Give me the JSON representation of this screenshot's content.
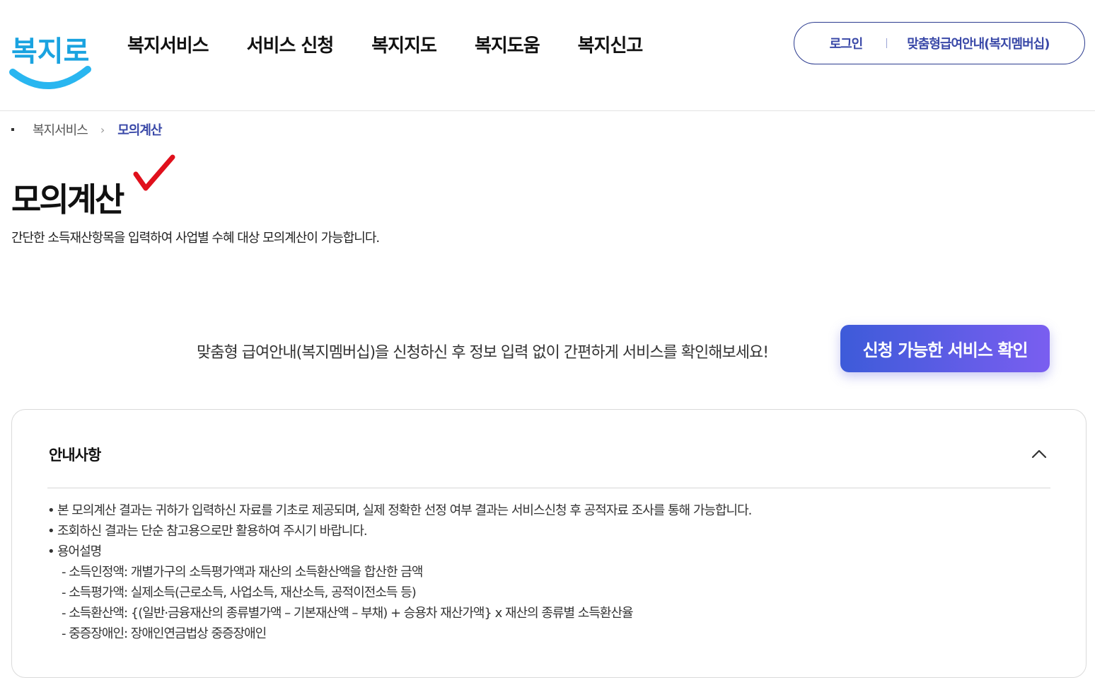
{
  "header": {
    "logo_text": "복지로",
    "nav": [
      "복지서비스",
      "서비스 신청",
      "복지지도",
      "복지도움",
      "복지신고"
    ],
    "auth": {
      "login": "로그인",
      "membership": "맞춤형급여안내(복지멤버십)"
    }
  },
  "breadcrumb": {
    "parent": "복지서비스",
    "current": "모의계산"
  },
  "page": {
    "title": "모의계산",
    "description": "간단한 소득재산항목을 입력하여 사업별 수혜 대상 모의계산이 가능합니다."
  },
  "promo": {
    "text": "맞춤형 급여안내(복지멤버십)을 신청하신 후 정보 입력 없이 간편하게 서비스를 확인해보세요!",
    "button": "신청 가능한 서비스 확인"
  },
  "notice": {
    "title": "안내사항",
    "items": [
      "본 모의계산 결과는 귀하가 입력하신 자료를 기초로 제공되며, 실제 정확한 선정 여부 결과는 서비스신청 후 공적자료 조사를 통해 가능합니다.",
      "조회하신 결과는 단순 참고용으로만 활용하여 주시기 바랍니다.",
      "용어설명"
    ],
    "terms": [
      "- 소득인정액: 개별가구의 소득평가액과 재산의 소득환산액을 합산한 금액",
      "- 소득평가액: 실제소득(근로소득, 사업소득, 재산소득, 공적이전소득 등)",
      "- 소득환산액: {(일반·금융재산의 종류별가액 – 기본재산액 – 부채) + 승용차 재산가액} x 재산의 종류별 소득환산율",
      "- 중증장애인: 장애인연금법상 중증장애인"
    ]
  },
  "colors": {
    "accent": "#3a49a8",
    "cta_start": "#3d5bd9",
    "cta_end": "#7a5ef0",
    "logo_blue": "#1aa3e0",
    "check_red": "#e0101c"
  }
}
